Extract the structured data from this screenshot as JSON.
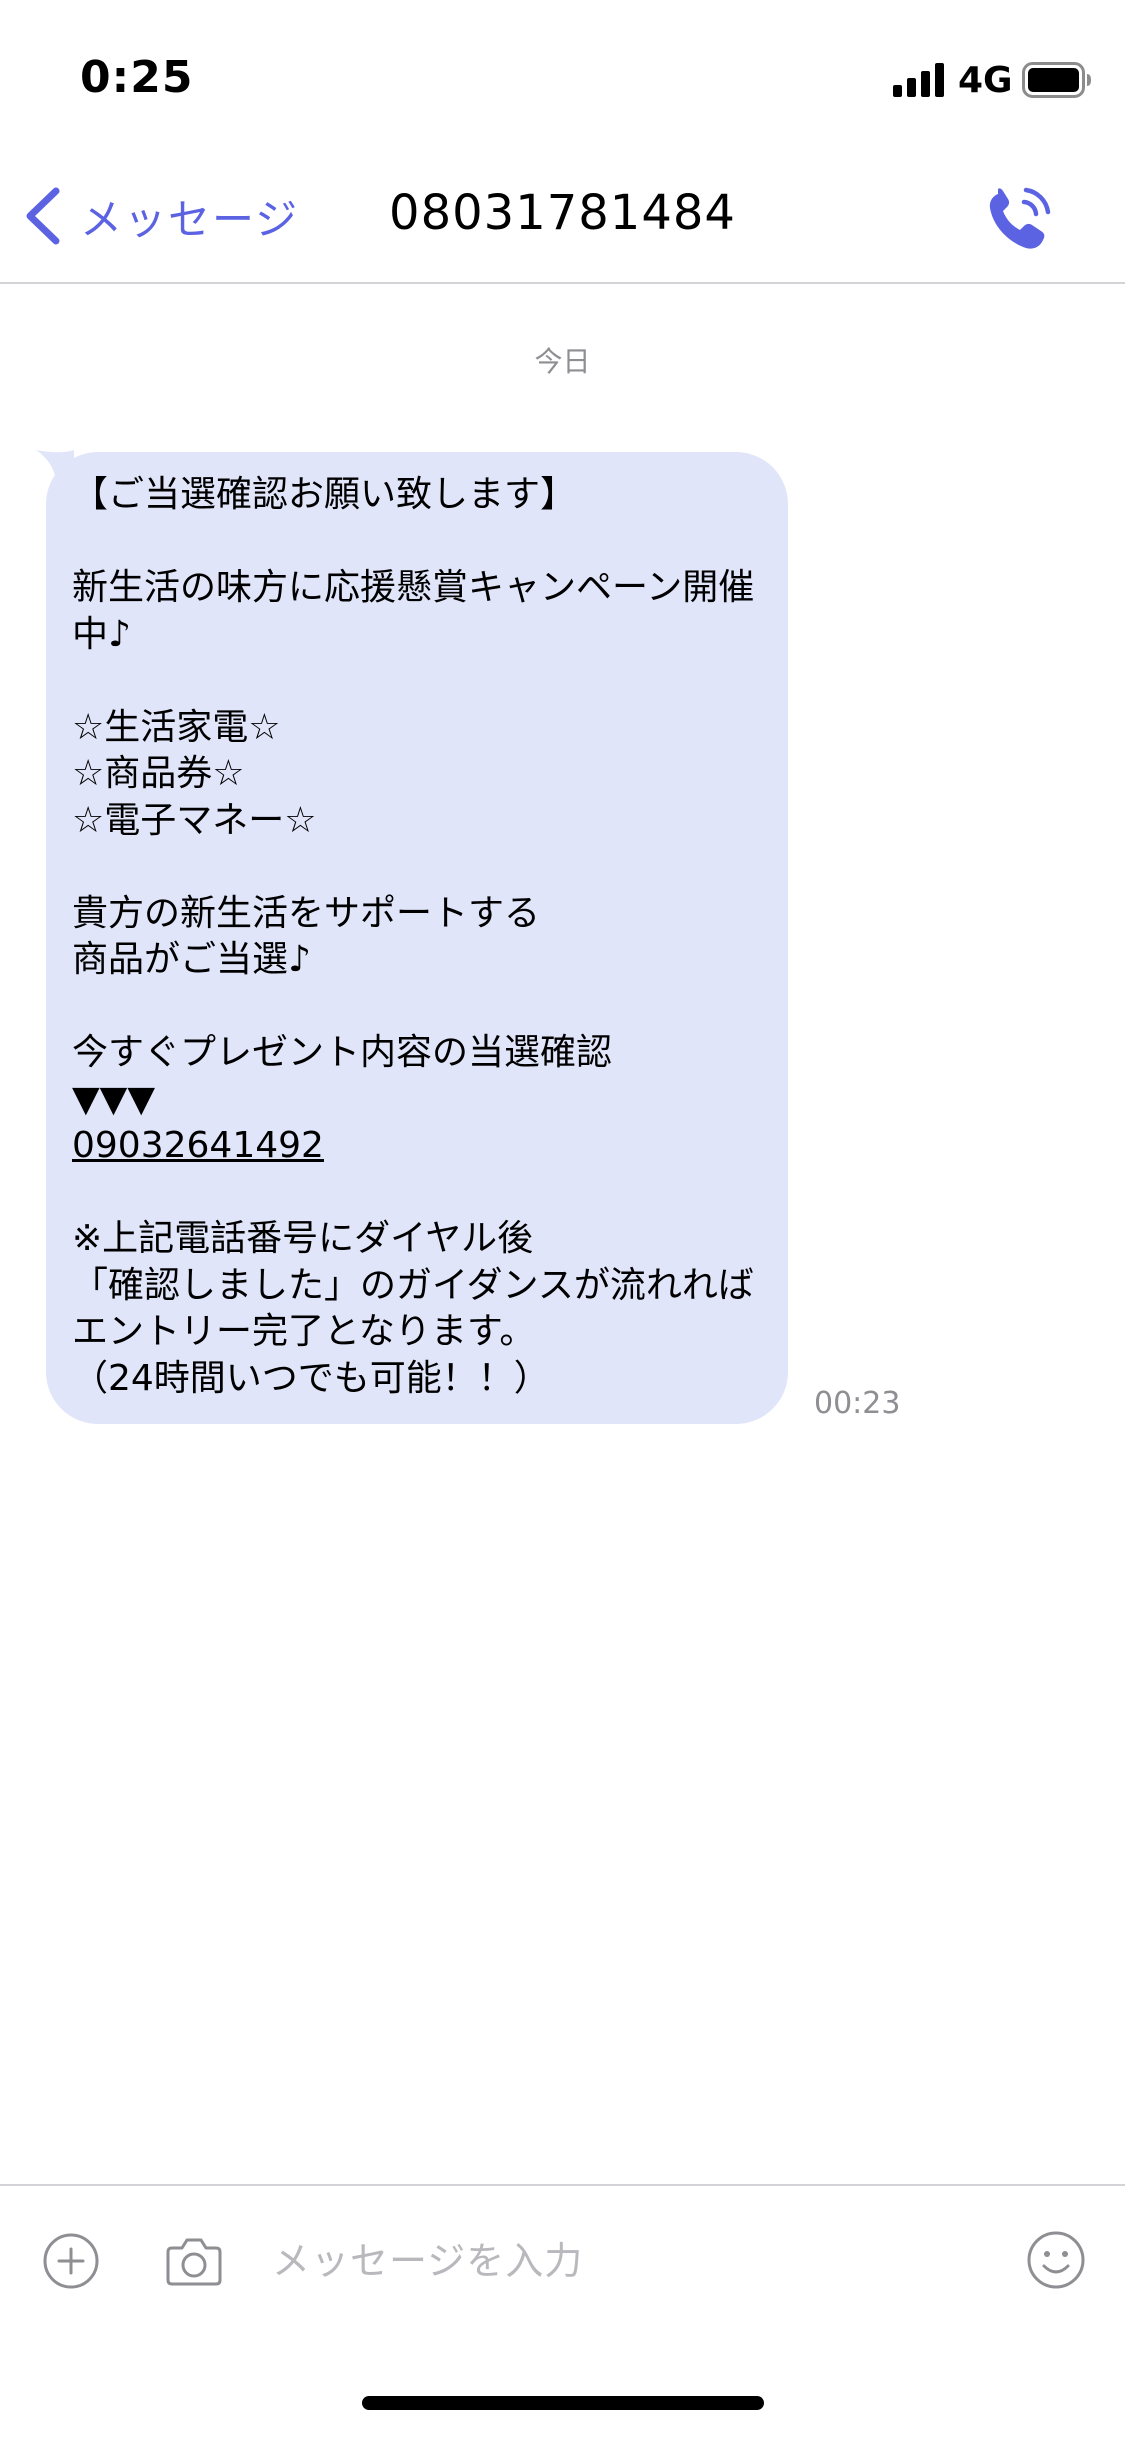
{
  "status_bar": {
    "time": "0:25",
    "network": "4G",
    "signal_icon": "signal-bars-icon",
    "battery_icon": "battery-icon"
  },
  "nav": {
    "back_label": "メッセージ",
    "back_icon": "chevron-left-icon",
    "title": "08031781484",
    "call_icon": "phone-icon"
  },
  "conversation": {
    "date_label": "今日",
    "message": {
      "lines": [
        "【ご当選確認お願い致します】",
        "",
        "新生活の味方に応援懸賞キャンペーン開催",
        "中♪",
        "",
        "☆生活家電☆",
        "☆商品券☆",
        "☆電子マネー☆",
        "",
        "貴方の新生活をサポートする",
        "商品がご当選♪",
        "",
        "今すぐプレゼント内容の当選確認",
        "▼▼▼",
        "09032641492",
        "",
        "※上記電話番号にダイヤル後",
        "「確認しました」のガイダンスが流れれば",
        "エントリー完了となります。",
        "（24時間いつでも可能！！）"
      ],
      "link_line_index": 14,
      "time": "00:23"
    }
  },
  "input_bar": {
    "placeholder": "メッセージを入力",
    "value": "",
    "add_icon": "plus-circle-icon",
    "camera_icon": "camera-icon",
    "emoji_icon": "smiley-icon"
  },
  "colors": {
    "accent": "#5b63e3",
    "bubble": "#e1e5f9",
    "timestamp": "#8e8e93",
    "divider": "#d4d4d8"
  }
}
